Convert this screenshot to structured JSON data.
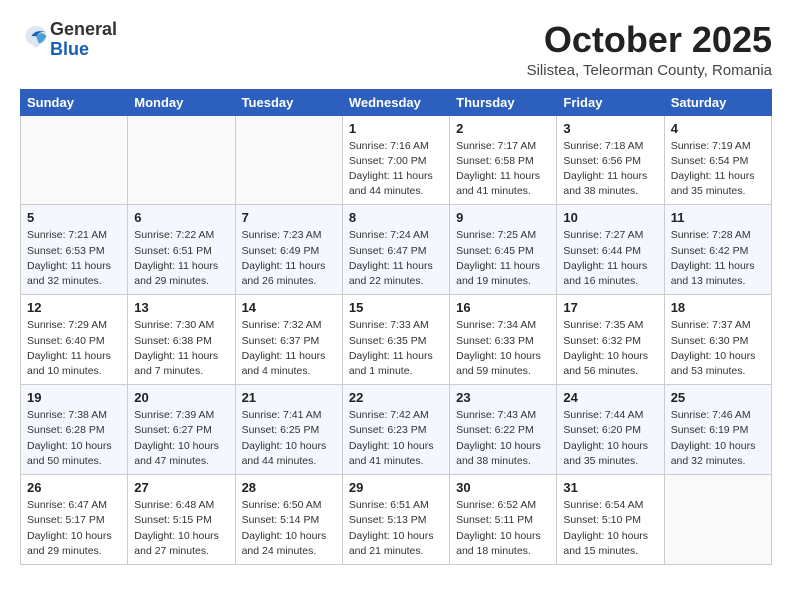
{
  "logo": {
    "general": "General",
    "blue": "Blue"
  },
  "title": "October 2025",
  "location": "Silistea, Teleorman County, Romania",
  "days_of_week": [
    "Sunday",
    "Monday",
    "Tuesday",
    "Wednesday",
    "Thursday",
    "Friday",
    "Saturday"
  ],
  "weeks": [
    [
      {
        "day": "",
        "info": ""
      },
      {
        "day": "",
        "info": ""
      },
      {
        "day": "",
        "info": ""
      },
      {
        "day": "1",
        "info": "Sunrise: 7:16 AM\nSunset: 7:00 PM\nDaylight: 11 hours and 44 minutes."
      },
      {
        "day": "2",
        "info": "Sunrise: 7:17 AM\nSunset: 6:58 PM\nDaylight: 11 hours and 41 minutes."
      },
      {
        "day": "3",
        "info": "Sunrise: 7:18 AM\nSunset: 6:56 PM\nDaylight: 11 hours and 38 minutes."
      },
      {
        "day": "4",
        "info": "Sunrise: 7:19 AM\nSunset: 6:54 PM\nDaylight: 11 hours and 35 minutes."
      }
    ],
    [
      {
        "day": "5",
        "info": "Sunrise: 7:21 AM\nSunset: 6:53 PM\nDaylight: 11 hours and 32 minutes."
      },
      {
        "day": "6",
        "info": "Sunrise: 7:22 AM\nSunset: 6:51 PM\nDaylight: 11 hours and 29 minutes."
      },
      {
        "day": "7",
        "info": "Sunrise: 7:23 AM\nSunset: 6:49 PM\nDaylight: 11 hours and 26 minutes."
      },
      {
        "day": "8",
        "info": "Sunrise: 7:24 AM\nSunset: 6:47 PM\nDaylight: 11 hours and 22 minutes."
      },
      {
        "day": "9",
        "info": "Sunrise: 7:25 AM\nSunset: 6:45 PM\nDaylight: 11 hours and 19 minutes."
      },
      {
        "day": "10",
        "info": "Sunrise: 7:27 AM\nSunset: 6:44 PM\nDaylight: 11 hours and 16 minutes."
      },
      {
        "day": "11",
        "info": "Sunrise: 7:28 AM\nSunset: 6:42 PM\nDaylight: 11 hours and 13 minutes."
      }
    ],
    [
      {
        "day": "12",
        "info": "Sunrise: 7:29 AM\nSunset: 6:40 PM\nDaylight: 11 hours and 10 minutes."
      },
      {
        "day": "13",
        "info": "Sunrise: 7:30 AM\nSunset: 6:38 PM\nDaylight: 11 hours and 7 minutes."
      },
      {
        "day": "14",
        "info": "Sunrise: 7:32 AM\nSunset: 6:37 PM\nDaylight: 11 hours and 4 minutes."
      },
      {
        "day": "15",
        "info": "Sunrise: 7:33 AM\nSunset: 6:35 PM\nDaylight: 11 hours and 1 minute."
      },
      {
        "day": "16",
        "info": "Sunrise: 7:34 AM\nSunset: 6:33 PM\nDaylight: 10 hours and 59 minutes."
      },
      {
        "day": "17",
        "info": "Sunrise: 7:35 AM\nSunset: 6:32 PM\nDaylight: 10 hours and 56 minutes."
      },
      {
        "day": "18",
        "info": "Sunrise: 7:37 AM\nSunset: 6:30 PM\nDaylight: 10 hours and 53 minutes."
      }
    ],
    [
      {
        "day": "19",
        "info": "Sunrise: 7:38 AM\nSunset: 6:28 PM\nDaylight: 10 hours and 50 minutes."
      },
      {
        "day": "20",
        "info": "Sunrise: 7:39 AM\nSunset: 6:27 PM\nDaylight: 10 hours and 47 minutes."
      },
      {
        "day": "21",
        "info": "Sunrise: 7:41 AM\nSunset: 6:25 PM\nDaylight: 10 hours and 44 minutes."
      },
      {
        "day": "22",
        "info": "Sunrise: 7:42 AM\nSunset: 6:23 PM\nDaylight: 10 hours and 41 minutes."
      },
      {
        "day": "23",
        "info": "Sunrise: 7:43 AM\nSunset: 6:22 PM\nDaylight: 10 hours and 38 minutes."
      },
      {
        "day": "24",
        "info": "Sunrise: 7:44 AM\nSunset: 6:20 PM\nDaylight: 10 hours and 35 minutes."
      },
      {
        "day": "25",
        "info": "Sunrise: 7:46 AM\nSunset: 6:19 PM\nDaylight: 10 hours and 32 minutes."
      }
    ],
    [
      {
        "day": "26",
        "info": "Sunrise: 6:47 AM\nSunset: 5:17 PM\nDaylight: 10 hours and 29 minutes."
      },
      {
        "day": "27",
        "info": "Sunrise: 6:48 AM\nSunset: 5:15 PM\nDaylight: 10 hours and 27 minutes."
      },
      {
        "day": "28",
        "info": "Sunrise: 6:50 AM\nSunset: 5:14 PM\nDaylight: 10 hours and 24 minutes."
      },
      {
        "day": "29",
        "info": "Sunrise: 6:51 AM\nSunset: 5:13 PM\nDaylight: 10 hours and 21 minutes."
      },
      {
        "day": "30",
        "info": "Sunrise: 6:52 AM\nSunset: 5:11 PM\nDaylight: 10 hours and 18 minutes."
      },
      {
        "day": "31",
        "info": "Sunrise: 6:54 AM\nSunset: 5:10 PM\nDaylight: 10 hours and 15 minutes."
      },
      {
        "day": "",
        "info": ""
      }
    ]
  ]
}
